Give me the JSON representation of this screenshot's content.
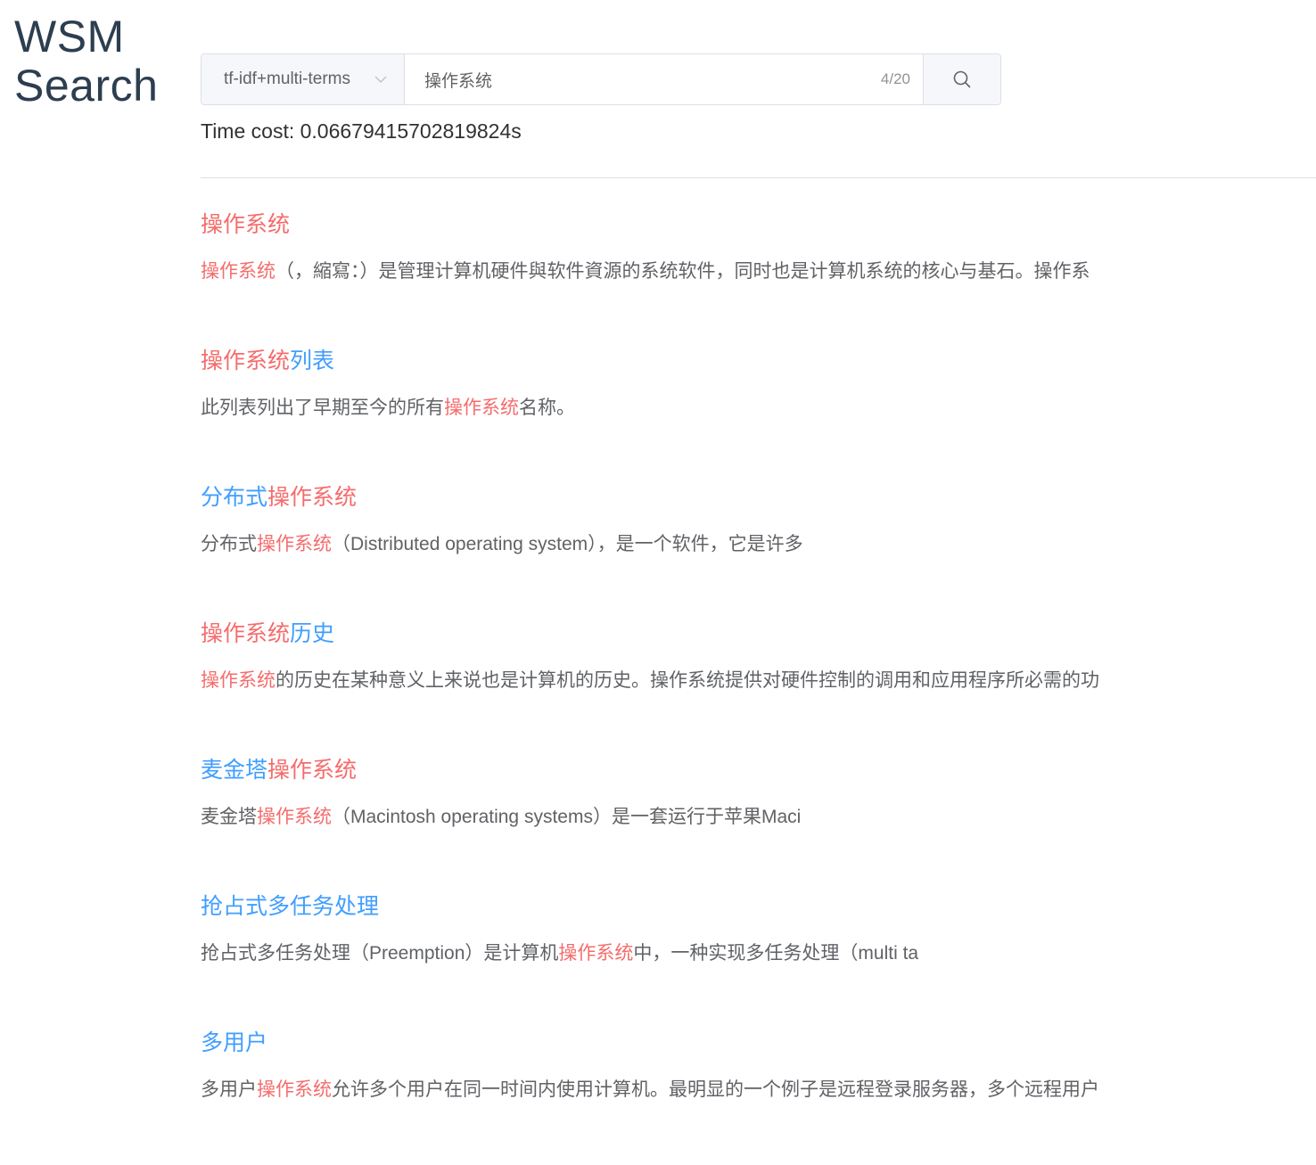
{
  "logo": {
    "line1": "WSM",
    "line2": "Search"
  },
  "search": {
    "method": "tf-idf+multi-terms",
    "query": "操作系统",
    "counter": "4/20"
  },
  "time_cost": "Time cost: 0.06679415702819824s",
  "colors": {
    "highlight": "#f56c6c",
    "link": "#409eff",
    "text": "#606266",
    "border": "#dcdfe6"
  },
  "icons": {
    "search_button": "search-icon",
    "select": "chevron-down-icon"
  },
  "results": [
    {
      "title": [
        {
          "t": "操作系统",
          "hl": true
        }
      ],
      "snippet": [
        {
          "t": "操作系统",
          "hl": true
        },
        {
          "t": "（，縮寫：）是管理计算机硬件與软件資源的系统软件，同时也是计算机系统的核心与基石。操作系"
        }
      ]
    },
    {
      "title": [
        {
          "t": "操作系统",
          "hl": true
        },
        {
          "t": "列表"
        }
      ],
      "snippet": [
        {
          "t": "此列表列出了早期至今的所有"
        },
        {
          "t": "操作系统",
          "hl": true
        },
        {
          "t": "名称。"
        }
      ]
    },
    {
      "title": [
        {
          "t": "分布式"
        },
        {
          "t": "操作系统",
          "hl": true
        }
      ],
      "snippet": [
        {
          "t": "分布式"
        },
        {
          "t": "操作系统",
          "hl": true
        },
        {
          "t": "（"
        },
        {
          "t": "Distributed operating system",
          "latin": true
        },
        {
          "t": "），是一个软件，它是许多"
        }
      ]
    },
    {
      "title": [
        {
          "t": "操作系统",
          "hl": true
        },
        {
          "t": "历史"
        }
      ],
      "snippet": [
        {
          "t": "操作系统",
          "hl": true
        },
        {
          "t": "的历史在某种意义上来说也是计算机的历史。操作系统提供对硬件控制的调用和应用程序所必需的功"
        }
      ]
    },
    {
      "title": [
        {
          "t": "麦金塔"
        },
        {
          "t": "操作系统",
          "hl": true
        }
      ],
      "snippet": [
        {
          "t": "麦金塔"
        },
        {
          "t": "操作系统",
          "hl": true
        },
        {
          "t": "（"
        },
        {
          "t": "Macintosh operating systems",
          "latin": true
        },
        {
          "t": "）是一套运行于苹果"
        },
        {
          "t": "Maci",
          "latin": true
        }
      ]
    },
    {
      "title": [
        {
          "t": "抢占式多任务处理"
        }
      ],
      "snippet": [
        {
          "t": "抢占式多任务处理（"
        },
        {
          "t": "Preemption",
          "latin": true
        },
        {
          "t": "）是计算机"
        },
        {
          "t": "操作系统",
          "hl": true
        },
        {
          "t": "中，一种实现多任务处理（"
        },
        {
          "t": "multi ta",
          "latin": true
        }
      ]
    },
    {
      "title": [
        {
          "t": "多用户"
        }
      ],
      "snippet": [
        {
          "t": "多用户"
        },
        {
          "t": "操作系统",
          "hl": true
        },
        {
          "t": "允许多个用户在同一时间内使用计算机。最明显的一个例子是远程登录服务器，多个远程用户"
        }
      ]
    }
  ]
}
